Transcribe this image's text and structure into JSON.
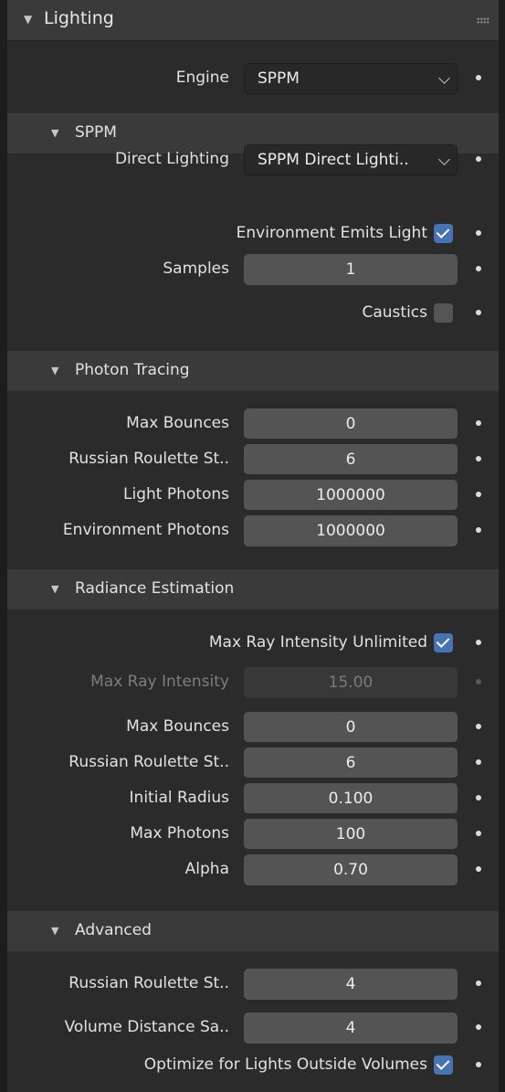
{
  "panel": {
    "title": "Lighting"
  },
  "engine": {
    "label": "Engine",
    "value": "SPPM"
  },
  "sppm": {
    "title": "SPPM",
    "direct_lighting": {
      "label": "Direct Lighting",
      "value": "SPPM Direct Lighti.."
    },
    "env_emits_light": {
      "label": "Environment Emits Light",
      "checked": true
    },
    "samples": {
      "label": "Samples",
      "value": "1"
    },
    "caustics": {
      "label": "Caustics",
      "checked": false
    }
  },
  "photon_tracing": {
    "title": "Photon Tracing",
    "max_bounces": {
      "label": "Max Bounces",
      "value": "0"
    },
    "russian_roulette": {
      "label": "Russian Roulette St..",
      "value": "6"
    },
    "light_photons": {
      "label": "Light Photons",
      "value": "1000000"
    },
    "environment_photons": {
      "label": "Environment Photons",
      "value": "1000000"
    }
  },
  "radiance_estimation": {
    "title": "Radiance Estimation",
    "max_ray_unlimited": {
      "label": "Max Ray Intensity Unlimited",
      "checked": true
    },
    "max_ray_intensity": {
      "label": "Max Ray Intensity",
      "value": "15.00"
    },
    "max_bounces": {
      "label": "Max Bounces",
      "value": "0"
    },
    "russian_roulette": {
      "label": "Russian Roulette St..",
      "value": "6"
    },
    "initial_radius": {
      "label": "Initial Radius",
      "value": "0.100"
    },
    "max_photons": {
      "label": "Max Photons",
      "value": "100"
    },
    "alpha": {
      "label": "Alpha",
      "value": "0.70"
    }
  },
  "advanced": {
    "title": "Advanced",
    "russian_roulette": {
      "label": "Russian Roulette St..",
      "value": "4"
    },
    "volume_distance": {
      "label": "Volume Distance Sa..",
      "value": "4"
    },
    "optimize_lights": {
      "label": "Optimize for Lights Outside Volumes",
      "checked": true
    }
  },
  "icons": {
    "collapse": "triangle-down-icon",
    "grip": "drag-grip-icon",
    "dropdown": "chevron-down-icon",
    "animate": "keyframe-dot-icon",
    "checkbox": "checkmark-icon"
  },
  "colors": {
    "accent": "#4772b3",
    "panel_bg": "#2b2b2b",
    "header_bg": "#3a3a3a",
    "field_bg": "#545454"
  }
}
